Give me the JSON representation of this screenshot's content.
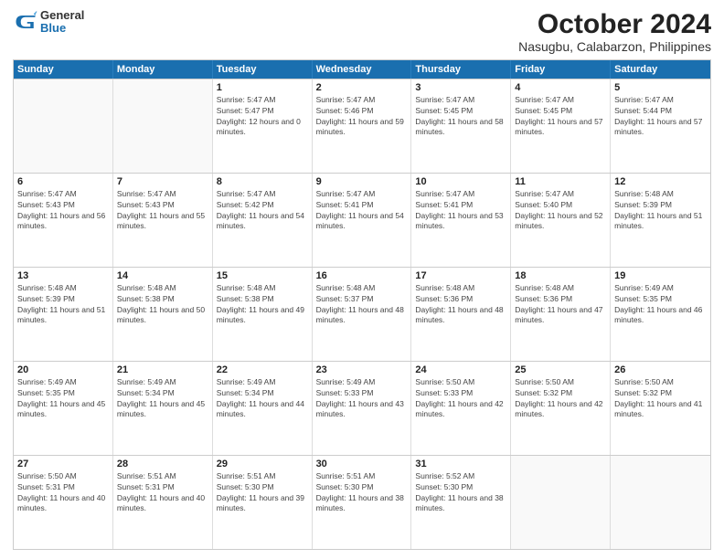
{
  "logo": {
    "general": "General",
    "blue": "Blue"
  },
  "title": "October 2024",
  "subtitle": "Nasugbu, Calabarzon, Philippines",
  "weekdays": [
    "Sunday",
    "Monday",
    "Tuesday",
    "Wednesday",
    "Thursday",
    "Friday",
    "Saturday"
  ],
  "weeks": [
    [
      {
        "day": "",
        "sunrise": "",
        "sunset": "",
        "daylight": ""
      },
      {
        "day": "",
        "sunrise": "",
        "sunset": "",
        "daylight": ""
      },
      {
        "day": "1",
        "sunrise": "Sunrise: 5:47 AM",
        "sunset": "Sunset: 5:47 PM",
        "daylight": "Daylight: 12 hours and 0 minutes."
      },
      {
        "day": "2",
        "sunrise": "Sunrise: 5:47 AM",
        "sunset": "Sunset: 5:46 PM",
        "daylight": "Daylight: 11 hours and 59 minutes."
      },
      {
        "day": "3",
        "sunrise": "Sunrise: 5:47 AM",
        "sunset": "Sunset: 5:45 PM",
        "daylight": "Daylight: 11 hours and 58 minutes."
      },
      {
        "day": "4",
        "sunrise": "Sunrise: 5:47 AM",
        "sunset": "Sunset: 5:45 PM",
        "daylight": "Daylight: 11 hours and 57 minutes."
      },
      {
        "day": "5",
        "sunrise": "Sunrise: 5:47 AM",
        "sunset": "Sunset: 5:44 PM",
        "daylight": "Daylight: 11 hours and 57 minutes."
      }
    ],
    [
      {
        "day": "6",
        "sunrise": "Sunrise: 5:47 AM",
        "sunset": "Sunset: 5:43 PM",
        "daylight": "Daylight: 11 hours and 56 minutes."
      },
      {
        "day": "7",
        "sunrise": "Sunrise: 5:47 AM",
        "sunset": "Sunset: 5:43 PM",
        "daylight": "Daylight: 11 hours and 55 minutes."
      },
      {
        "day": "8",
        "sunrise": "Sunrise: 5:47 AM",
        "sunset": "Sunset: 5:42 PM",
        "daylight": "Daylight: 11 hours and 54 minutes."
      },
      {
        "day": "9",
        "sunrise": "Sunrise: 5:47 AM",
        "sunset": "Sunset: 5:41 PM",
        "daylight": "Daylight: 11 hours and 54 minutes."
      },
      {
        "day": "10",
        "sunrise": "Sunrise: 5:47 AM",
        "sunset": "Sunset: 5:41 PM",
        "daylight": "Daylight: 11 hours and 53 minutes."
      },
      {
        "day": "11",
        "sunrise": "Sunrise: 5:47 AM",
        "sunset": "Sunset: 5:40 PM",
        "daylight": "Daylight: 11 hours and 52 minutes."
      },
      {
        "day": "12",
        "sunrise": "Sunrise: 5:48 AM",
        "sunset": "Sunset: 5:39 PM",
        "daylight": "Daylight: 11 hours and 51 minutes."
      }
    ],
    [
      {
        "day": "13",
        "sunrise": "Sunrise: 5:48 AM",
        "sunset": "Sunset: 5:39 PM",
        "daylight": "Daylight: 11 hours and 51 minutes."
      },
      {
        "day": "14",
        "sunrise": "Sunrise: 5:48 AM",
        "sunset": "Sunset: 5:38 PM",
        "daylight": "Daylight: 11 hours and 50 minutes."
      },
      {
        "day": "15",
        "sunrise": "Sunrise: 5:48 AM",
        "sunset": "Sunset: 5:38 PM",
        "daylight": "Daylight: 11 hours and 49 minutes."
      },
      {
        "day": "16",
        "sunrise": "Sunrise: 5:48 AM",
        "sunset": "Sunset: 5:37 PM",
        "daylight": "Daylight: 11 hours and 48 minutes."
      },
      {
        "day": "17",
        "sunrise": "Sunrise: 5:48 AM",
        "sunset": "Sunset: 5:36 PM",
        "daylight": "Daylight: 11 hours and 48 minutes."
      },
      {
        "day": "18",
        "sunrise": "Sunrise: 5:48 AM",
        "sunset": "Sunset: 5:36 PM",
        "daylight": "Daylight: 11 hours and 47 minutes."
      },
      {
        "day": "19",
        "sunrise": "Sunrise: 5:49 AM",
        "sunset": "Sunset: 5:35 PM",
        "daylight": "Daylight: 11 hours and 46 minutes."
      }
    ],
    [
      {
        "day": "20",
        "sunrise": "Sunrise: 5:49 AM",
        "sunset": "Sunset: 5:35 PM",
        "daylight": "Daylight: 11 hours and 45 minutes."
      },
      {
        "day": "21",
        "sunrise": "Sunrise: 5:49 AM",
        "sunset": "Sunset: 5:34 PM",
        "daylight": "Daylight: 11 hours and 45 minutes."
      },
      {
        "day": "22",
        "sunrise": "Sunrise: 5:49 AM",
        "sunset": "Sunset: 5:34 PM",
        "daylight": "Daylight: 11 hours and 44 minutes."
      },
      {
        "day": "23",
        "sunrise": "Sunrise: 5:49 AM",
        "sunset": "Sunset: 5:33 PM",
        "daylight": "Daylight: 11 hours and 43 minutes."
      },
      {
        "day": "24",
        "sunrise": "Sunrise: 5:50 AM",
        "sunset": "Sunset: 5:33 PM",
        "daylight": "Daylight: 11 hours and 42 minutes."
      },
      {
        "day": "25",
        "sunrise": "Sunrise: 5:50 AM",
        "sunset": "Sunset: 5:32 PM",
        "daylight": "Daylight: 11 hours and 42 minutes."
      },
      {
        "day": "26",
        "sunrise": "Sunrise: 5:50 AM",
        "sunset": "Sunset: 5:32 PM",
        "daylight": "Daylight: 11 hours and 41 minutes."
      }
    ],
    [
      {
        "day": "27",
        "sunrise": "Sunrise: 5:50 AM",
        "sunset": "Sunset: 5:31 PM",
        "daylight": "Daylight: 11 hours and 40 minutes."
      },
      {
        "day": "28",
        "sunrise": "Sunrise: 5:51 AM",
        "sunset": "Sunset: 5:31 PM",
        "daylight": "Daylight: 11 hours and 40 minutes."
      },
      {
        "day": "29",
        "sunrise": "Sunrise: 5:51 AM",
        "sunset": "Sunset: 5:30 PM",
        "daylight": "Daylight: 11 hours and 39 minutes."
      },
      {
        "day": "30",
        "sunrise": "Sunrise: 5:51 AM",
        "sunset": "Sunset: 5:30 PM",
        "daylight": "Daylight: 11 hours and 38 minutes."
      },
      {
        "day": "31",
        "sunrise": "Sunrise: 5:52 AM",
        "sunset": "Sunset: 5:30 PM",
        "daylight": "Daylight: 11 hours and 38 minutes."
      },
      {
        "day": "",
        "sunrise": "",
        "sunset": "",
        "daylight": ""
      },
      {
        "day": "",
        "sunrise": "",
        "sunset": "",
        "daylight": ""
      }
    ]
  ]
}
